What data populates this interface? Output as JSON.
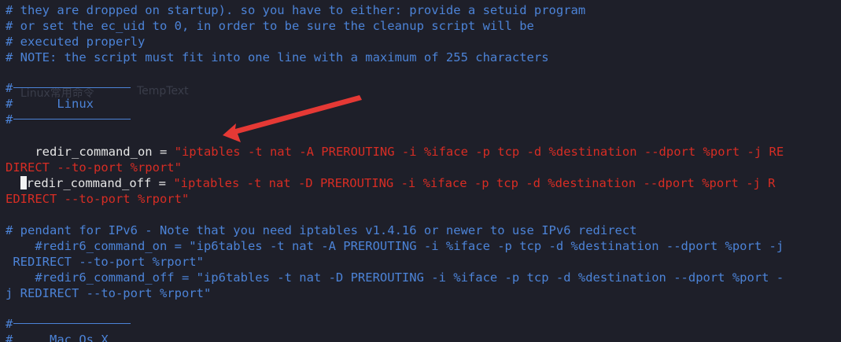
{
  "editor": {
    "lines": [
      "# they are dropped on startup). so you have to either: provide a setuid program",
      "# or set the ec_uid to 0, in order to be sure the cleanup script will be",
      "# executed properly",
      "# NOTE: the script must fit into one line with a maximum of 255 characters"
    ],
    "linux_header_label": "Linux",
    "redir_on_key": "    redir_command_on = ",
    "redir_on_value_1": "\"iptables -t nat -A PREROUTING -i %iface -p tcp -d %destination --dport %port -j RE",
    "redir_on_value_2": "DIRECT --to-port %rport\"",
    "redir_off_key": "redir_command_off = ",
    "redir_off_value_1": "\"iptables -t nat -D PREROUTING -i %iface -p tcp -d %destination --dport %port -j R",
    "redir_off_value_2": "EDIRECT --to-port %rport\"",
    "ipv6_comment": "# pendant for IPv6 - Note that you need iptables v1.4.16 or newer to use IPv6 redirect",
    "redir6_on_1": "    #redir6_command_on = \"ip6tables -t nat -A PREROUTING -i %iface -p tcp -d %destination --dport %port -j",
    "redir6_on_2": " REDIRECT --to-port %rport\"",
    "redir6_off_1": "    #redir6_command_off = \"ip6tables -t nat -D PREROUTING -i %iface -p tcp -d %destination --dport %port -",
    "redir6_off_2": "j REDIRECT --to-port %rport\"",
    "macos_header_label": "Mac Os X"
  },
  "overlay": {
    "ghost_label_1": "Linux常用命令",
    "ghost_label_2": "TempText"
  },
  "colors": {
    "background": "#1e1f29",
    "comment": "#4c83d7",
    "string": "#d72d24",
    "text": "#e6e6e6",
    "arrow": "#e53935"
  },
  "icons": {
    "arrow": "red-annotation-arrow-icon",
    "cursor": "block-cursor"
  }
}
